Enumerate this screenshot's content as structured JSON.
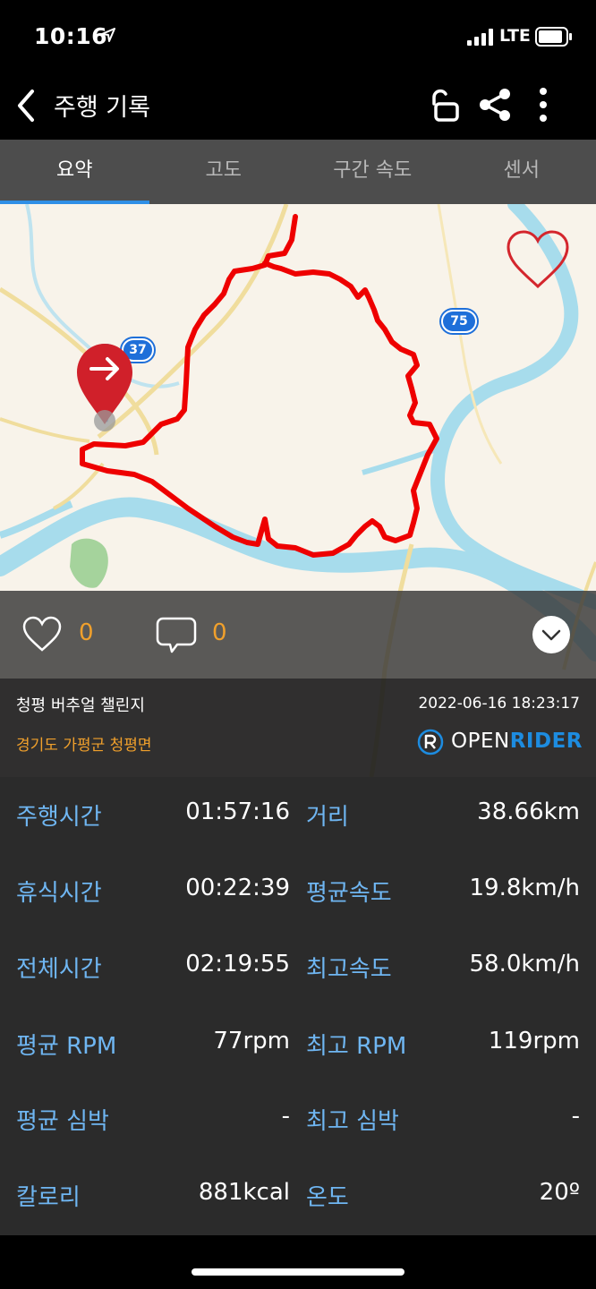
{
  "status_bar": {
    "time": "10:16",
    "network": "LTE"
  },
  "nav": {
    "title": "주행 기록"
  },
  "tabs": [
    {
      "label": "요약",
      "active": true
    },
    {
      "label": "고도",
      "active": false
    },
    {
      "label": "구간 속도",
      "active": false
    },
    {
      "label": "센서",
      "active": false
    }
  ],
  "map": {
    "route_badges": [
      "37",
      "75"
    ]
  },
  "social": {
    "likes": "0",
    "comments": "0"
  },
  "ride": {
    "name": "청평 버추얼 챌린지",
    "datetime": "2022-06-16 18:23:17",
    "location": "경기도 가평군 청평면"
  },
  "brand": {
    "open": "OPEN",
    "rider": "RIDER"
  },
  "stats": [
    {
      "left_label": "주행시간",
      "left_value": "01:57:16",
      "right_label": "거리",
      "right_value": "38.66km"
    },
    {
      "left_label": "휴식시간",
      "left_value": "00:22:39",
      "right_label": "평균속도",
      "right_value": "19.8km/h"
    },
    {
      "left_label": "전체시간",
      "left_value": "02:19:55",
      "right_label": "최고속도",
      "right_value": "58.0km/h"
    },
    {
      "left_label": "평균 RPM",
      "left_value": "77rpm",
      "right_label": "최고 RPM",
      "right_value": "119rpm"
    },
    {
      "left_label": "평균 심박",
      "left_value": "-",
      "right_label": "최고 심박",
      "right_value": "-"
    },
    {
      "left_label": "칼로리",
      "left_value": "881kcal",
      "right_label": "온도",
      "right_value": "20º"
    }
  ],
  "colors": {
    "accent_blue": "#2f8fe6",
    "label_blue": "#6fb6f2",
    "orange": "#f0a02c",
    "route_red": "#ee0000"
  }
}
